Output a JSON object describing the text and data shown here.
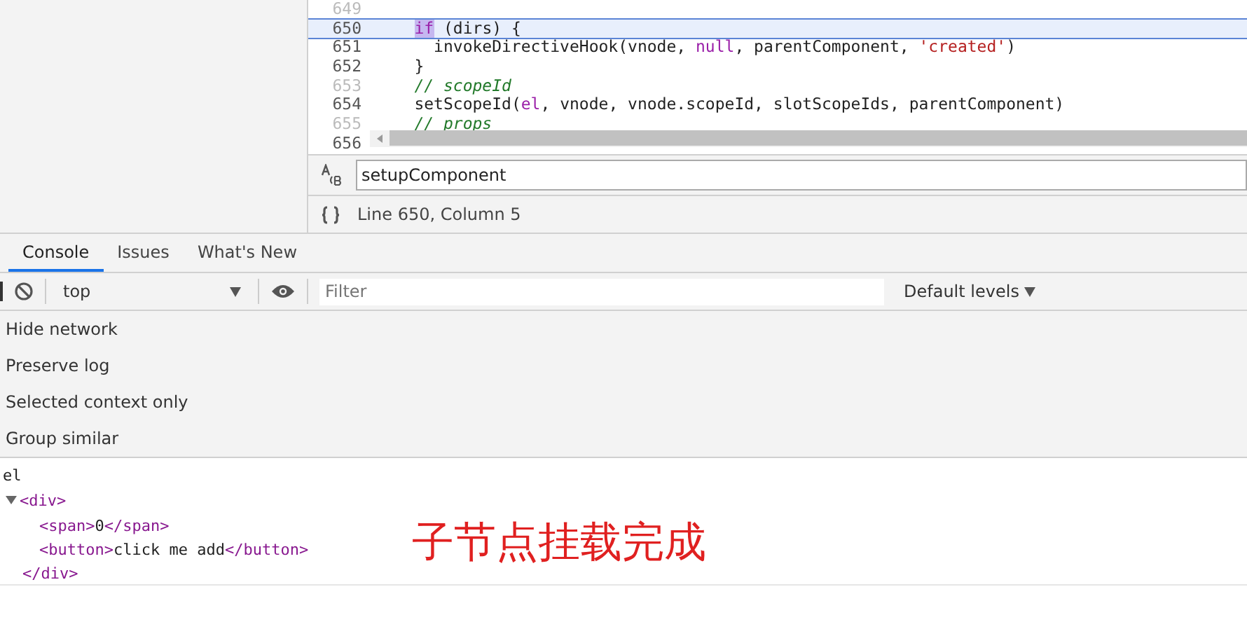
{
  "editor": {
    "lines": [
      {
        "number": "649",
        "dim": true,
        "selected": false
      },
      {
        "number": "650",
        "dim": false,
        "selected": true,
        "segments": [
          {
            "kind": "keyword",
            "text": "    if",
            "match": true
          },
          {
            "kind": "plain",
            "text": " (dirs) {",
            "match": false
          }
        ]
      },
      {
        "number": "651",
        "dim": false,
        "selected": false,
        "segments": [
          {
            "kind": "plain",
            "text": "      invokeDirectiveHook(vnode, "
          },
          {
            "kind": "keyword",
            "text": "null"
          },
          {
            "kind": "plain",
            "text": ", parentComponent, "
          },
          {
            "kind": "string",
            "text": "'created'"
          },
          {
            "kind": "plain",
            "text": ")"
          }
        ]
      },
      {
        "number": "652",
        "dim": false,
        "selected": false,
        "segments": [
          {
            "kind": "plain",
            "text": "    }"
          }
        ]
      },
      {
        "number": "653",
        "dim": true,
        "selected": false,
        "segments": [
          {
            "kind": "comment",
            "text": "    // scopeId"
          }
        ]
      },
      {
        "number": "654",
        "dim": false,
        "selected": false,
        "segments": [
          {
            "kind": "plain",
            "text": "    setScopeId("
          },
          {
            "kind": "keyword",
            "text": "el"
          },
          {
            "kind": "plain",
            "text": ", vnode, vnode.scopeId, slotScopeIds, parentComponent)"
          }
        ]
      },
      {
        "number": "655",
        "dim": true,
        "selected": false,
        "segments": [
          {
            "kind": "comment",
            "text": "    // props"
          }
        ]
      },
      {
        "number": "656",
        "dim": false,
        "selected": false
      }
    ],
    "search": {
      "value": "setupComponent"
    },
    "status": "Line 650, Column 5"
  },
  "tabs": [
    {
      "label": "Console",
      "selected": true
    },
    {
      "label": "Issues",
      "selected": false
    },
    {
      "label": "What's New",
      "selected": false
    }
  ],
  "toolbar": {
    "context": "top",
    "filter_placeholder": "Filter",
    "levels": "Default levels"
  },
  "settings": [
    "Hide network",
    "Preserve log",
    "Selected context only",
    "Group similar"
  ],
  "console": [
    {
      "kind": "text",
      "text": "el"
    },
    {
      "kind": "element",
      "open": "<div>",
      "close": "</div>",
      "expanded": true,
      "children": [
        {
          "tag_open": "<span>",
          "content": "0",
          "tag_close": "</span>"
        },
        {
          "tag_open": "<button>",
          "content": "click me add",
          "tag_close": "</button>"
        }
      ]
    }
  ],
  "annotation": "子节点挂载完成"
}
